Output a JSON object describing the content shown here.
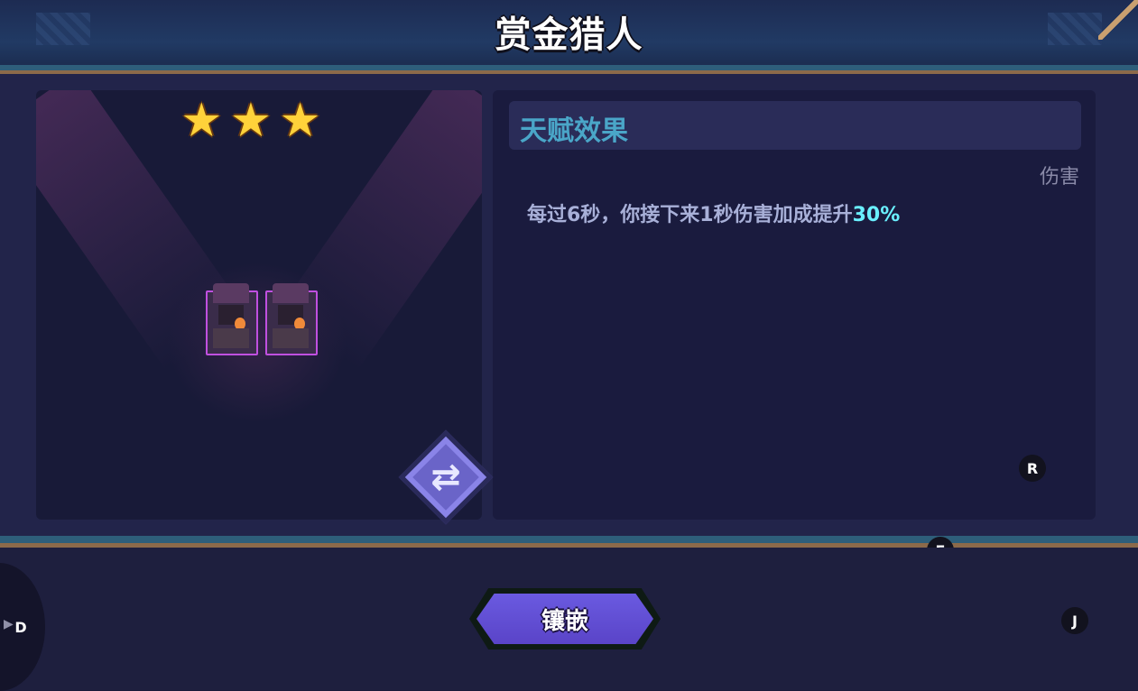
{
  "header": {
    "title": "赏金猎人"
  },
  "left_pane": {
    "star_count": 3,
    "star_icon": "star-icon",
    "hero_count": 2
  },
  "talent": {
    "title": "天赋效果",
    "tag": "伤害",
    "description_prefix": "每过6秒，你接下来1秒伤害加成提升",
    "description_highlight": "30%"
  },
  "keys": {
    "r": "R",
    "e": "E",
    "j": "J",
    "d": "D"
  },
  "footer": {
    "embed_label": "镶嵌"
  },
  "colors": {
    "accent": "#6af0ff",
    "button": "#5a44c8",
    "star": "#ffd23a"
  }
}
